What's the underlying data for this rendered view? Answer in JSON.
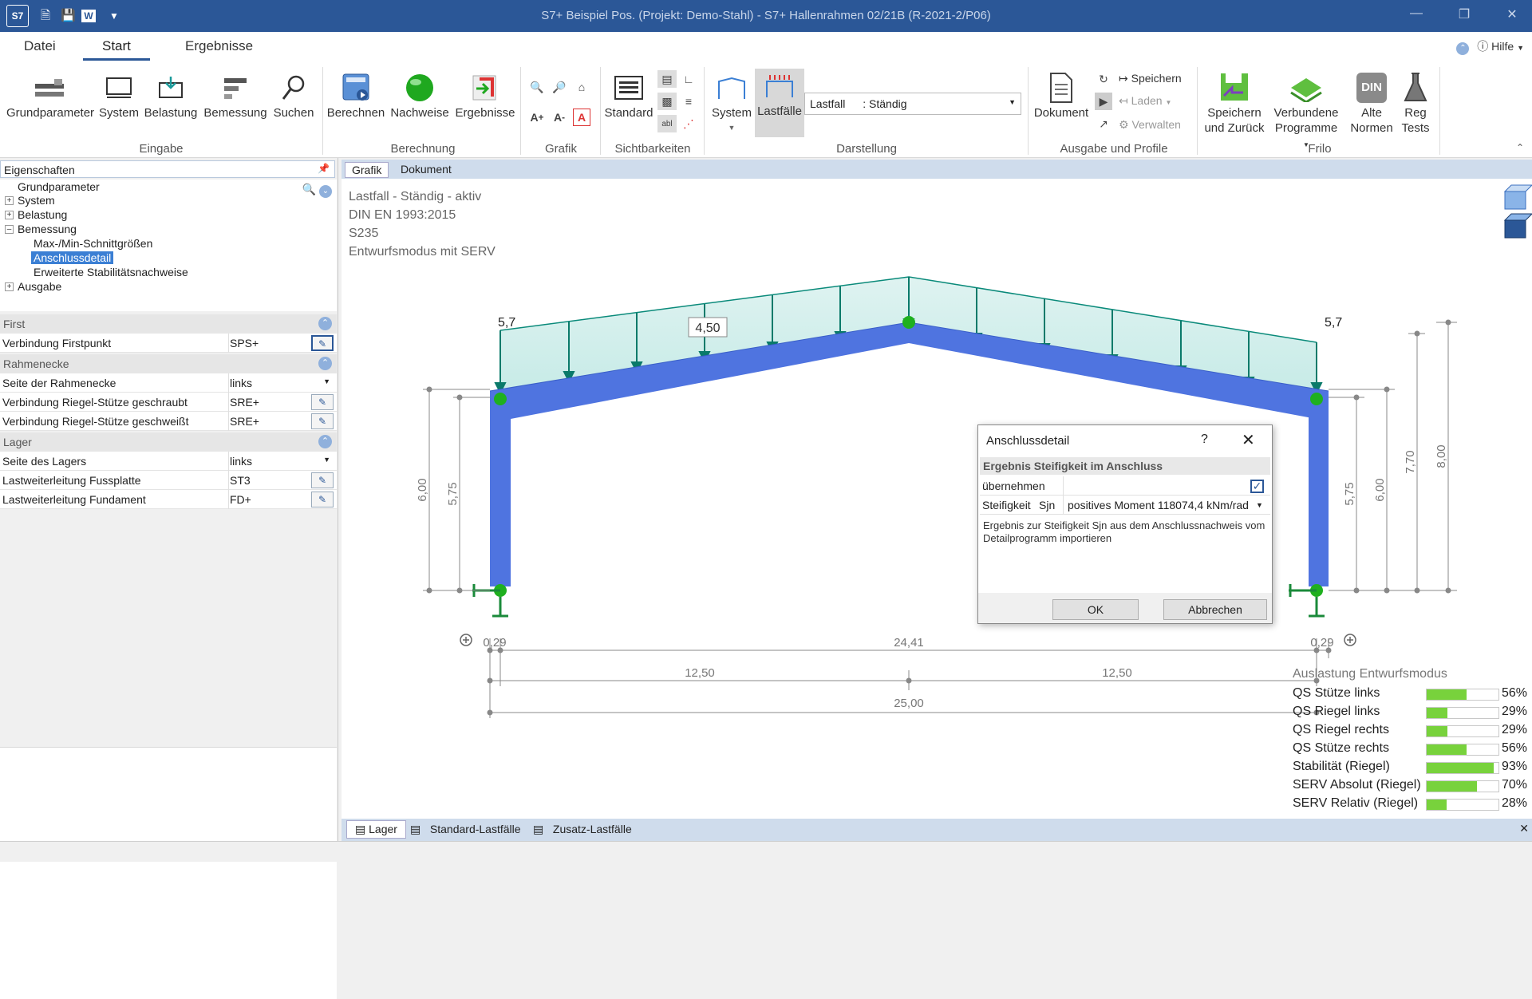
{
  "window": {
    "app_icon_label": "S7",
    "title": "S7+ Beispiel Pos. (Projekt: Demo-Stahl) - S7+ Hallenrahmen 02/21B (R-2021-2/P06)"
  },
  "menu": {
    "tabs": [
      {
        "label": "Datei"
      },
      {
        "label": "Start"
      },
      {
        "label": "Ergebnisse"
      }
    ],
    "help_label": "Hilfe"
  },
  "ribbon": {
    "eingabe": {
      "group": "Eingabe",
      "grundparameter": "Grundparameter",
      "system": "System",
      "belastung": "Belastung",
      "bemessung": "Bemessung",
      "suchen": "Suchen"
    },
    "berechnung": {
      "group": "Berechnung",
      "berechnen": "Berechnen",
      "nachweise": "Nachweise",
      "ergebnisse": "Ergebnisse"
    },
    "grafik": {
      "group": "Grafik"
    },
    "sichtbarkeiten": {
      "group": "Sichtbarkeiten",
      "standard": "Standard"
    },
    "darstellung": {
      "group": "Darstellung",
      "system": "System",
      "lastfaelle": "Lastfälle",
      "combo_label": "Lastfall",
      "combo_value": ": Ständig"
    },
    "ausgabe": {
      "group": "Ausgabe und Profile",
      "dokument": "Dokument",
      "speichern": "Speichern",
      "laden": "Laden",
      "verwalten": "Verwalten"
    },
    "frilo": {
      "group": "Frilo",
      "speichern_zurueck_1": "Speichern",
      "speichern_zurueck_2": "und Zurück",
      "verbundene_1": "Verbundene",
      "verbundene_2": "Programme",
      "alte_1": "Alte",
      "alte_2": "Normen",
      "reg_1": "Reg",
      "reg_2": "Tests",
      "din_icon_text": "DIN"
    }
  },
  "properties": {
    "header": "Eigenschaften",
    "tree": [
      "Grundparameter",
      "System",
      "Belastung",
      "Bemessung",
      "Max-/Min-Schnittgrößen",
      "Anschlussdetail",
      "Erweiterte Stabilitätsnachweise",
      "Ausgabe"
    ],
    "sections": {
      "first": "First",
      "rahmenecke": "Rahmenecke",
      "lager": "Lager"
    },
    "rows": [
      {
        "label": "Verbindung Firstpunkt",
        "value": "SPS+"
      },
      {
        "label": "Seite der Rahmenecke",
        "value": "links"
      },
      {
        "label": "Verbindung Riegel-Stütze geschraubt",
        "value": "SRE+"
      },
      {
        "label": "Verbindung Riegel-Stütze geschweißt",
        "value": "SRE+"
      },
      {
        "label": "Seite des Lagers",
        "value": "links"
      },
      {
        "label": "Lastweiterleitung Fussplatte",
        "value": "ST3"
      },
      {
        "label": "Lastweiterleitung Fundament",
        "value": "FD+"
      }
    ]
  },
  "doc_tabs": [
    {
      "label": "Grafik"
    },
    {
      "label": "Dokument"
    }
  ],
  "graphic": {
    "info": [
      "Lastfall - Ständig - aktiv",
      "DIN EN 1993:2015",
      "S235",
      "Entwurfsmodus mit SERV"
    ],
    "labels": {
      "load_left": "5,7",
      "load_right": "5,7",
      "load_mid": "4,50",
      "dim_left_col_outer": "6,00",
      "dim_left_col_inner": "5,75",
      "dim_right_col_inner": "5,75",
      "dim_right_col_outer": "6,00",
      "dim_height_770": "7,70",
      "dim_height_800": "8,00",
      "dim_0_29_left": "0,29",
      "dim_24_41": "24,41",
      "dim_0_29_right": "0,29",
      "dim_12_50_left": "12,50",
      "dim_12_50_right": "12,50",
      "dim_25_00": "25,00"
    }
  },
  "utilization": {
    "title": "Auslastung Entwurfsmodus",
    "rows": [
      {
        "name": "QS Stütze links",
        "value": 56,
        "label": "56%"
      },
      {
        "name": "QS Riegel links",
        "value": 29,
        "label": "29%"
      },
      {
        "name": "QS Riegel rechts",
        "value": 29,
        "label": "29%"
      },
      {
        "name": "QS Stütze rechts",
        "value": 56,
        "label": "56%"
      },
      {
        "name": "Stabilität (Riegel)",
        "value": 93,
        "label": "93%"
      },
      {
        "name": "SERV Absolut (Riegel)",
        "value": 70,
        "label": "70%"
      },
      {
        "name": "SERV Relativ (Riegel)",
        "value": 28,
        "label": "28%"
      }
    ]
  },
  "dialog": {
    "title": "Anschlussdetail",
    "help": "?",
    "section": "Ergebnis Steifigkeit im Anschluss",
    "row1_label": "übernehmen",
    "row2_label": "Steifigkeit",
    "row2_sub": "Sjn",
    "row2_value": "positives Moment  118074,4 kNm/rad",
    "description": "Ergebnis zur Steifigkeit Sjn aus dem Anschlussnachweis vom Detailprogramm importieren",
    "ok": "OK",
    "cancel": "Abbrechen"
  },
  "bottom_tabs": [
    {
      "label": "Lager"
    },
    {
      "label": "Standard-Lastfälle"
    },
    {
      "label": "Zusatz-Lastfälle"
    }
  ],
  "colors": {
    "accent": "#2b5797",
    "beam": "#4f74e0",
    "node": "#1fb01f",
    "load": "#0a7a6a",
    "util_fill": "#78d23c"
  }
}
